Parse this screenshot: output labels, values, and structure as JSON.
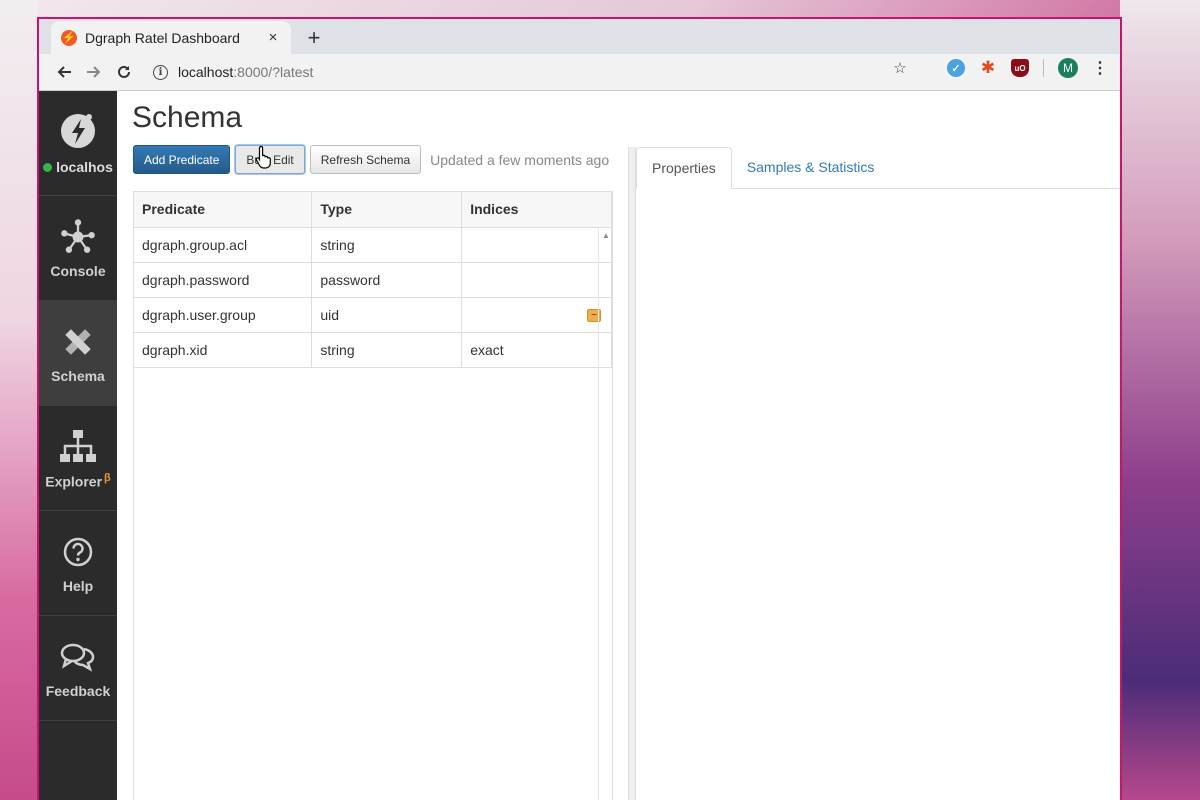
{
  "browser": {
    "tab_title": "Dgraph Ratel Dashboard",
    "tab_close": "×",
    "new_tab": "+",
    "url_host": "localhost",
    "url_rest": ":8000/?latest",
    "avatar_initial": "M"
  },
  "sidebar": {
    "connection": "localhos",
    "items": [
      {
        "label": "Console",
        "icon": "graph-nodes-icon"
      },
      {
        "label": "Schema",
        "icon": "pencil-ruler-icon",
        "active": true
      },
      {
        "label": "Explorer",
        "icon": "org-chart-icon",
        "badge": "β"
      },
      {
        "label": "Help",
        "icon": "question-circle-icon"
      },
      {
        "label": "Feedback",
        "icon": "speech-bubbles-icon"
      }
    ]
  },
  "main": {
    "title": "Schema",
    "buttons": {
      "add_predicate": "Add Predicate",
      "bulk_edit": "Bulk Edit",
      "refresh_schema": "Refresh Schema"
    },
    "updated_text": "Updated a few moments ago",
    "table": {
      "headers": [
        "Predicate",
        "Type",
        "Indices"
      ],
      "rows": [
        {
          "predicate": "dgraph.group.acl",
          "type": "string",
          "indices": ""
        },
        {
          "predicate": "dgraph.password",
          "type": "password",
          "indices": ""
        },
        {
          "predicate": "dgraph.user.group",
          "type": "uid",
          "indices": "",
          "badge": "~"
        },
        {
          "predicate": "dgraph.xid",
          "type": "string",
          "indices": "exact"
        }
      ]
    },
    "right_tabs": [
      "Properties",
      "Samples & Statistics"
    ]
  },
  "colors": {
    "window_border": "#c8136f",
    "sidebar_bg": "#2b2b2b",
    "primary_button": "#337ab7",
    "link": "#337ab7",
    "status_green": "#38b24a",
    "badge_orange": "#f0ad4e"
  }
}
